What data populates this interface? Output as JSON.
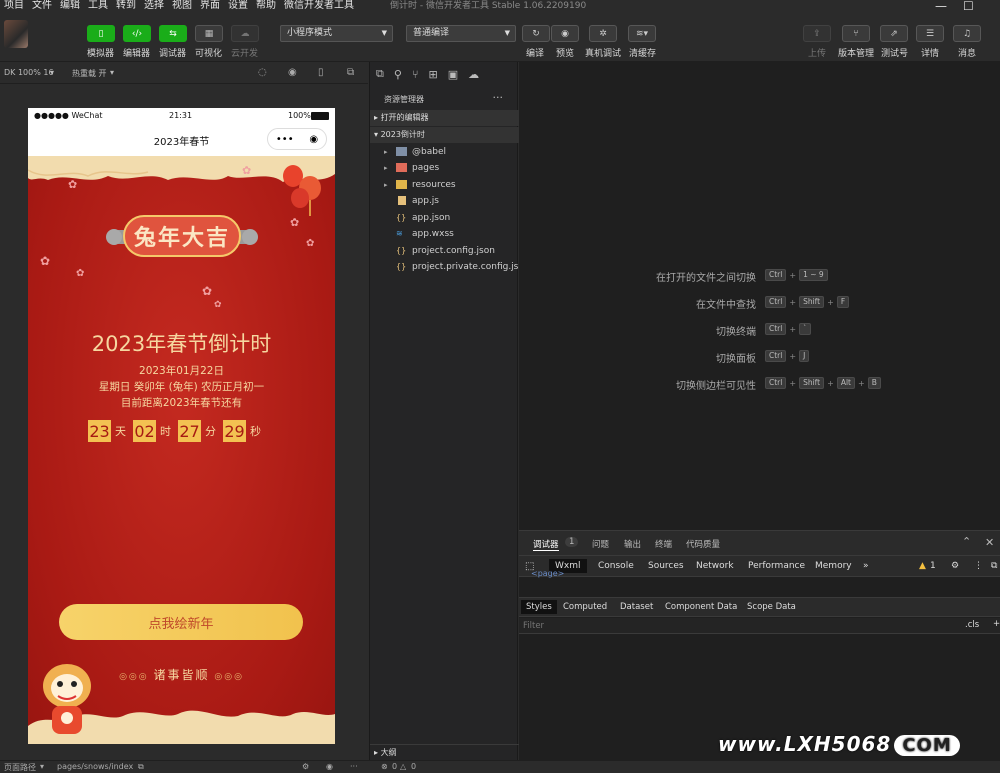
{
  "menu": [
    "项目",
    "文件",
    "编辑",
    "工具",
    "转到",
    "选择",
    "视图",
    "界面",
    "设置",
    "帮助",
    "微信开发者工具"
  ],
  "window_title": "倒计时      - 微信开发者工具 Stable 1.06.2209190",
  "toolbar": {
    "left_buttons": [
      {
        "label": "模拟器",
        "icon": "phone-icon"
      },
      {
        "label": "编辑器",
        "icon": "code-icon"
      },
      {
        "label": "调试器",
        "icon": "debug-icon"
      },
      {
        "label": "可视化",
        "icon": "layout-icon"
      },
      {
        "label": "云开发",
        "icon": "cloud-icon"
      }
    ],
    "mode_select": "小程序模式",
    "compile_select": "普通编译",
    "mid_buttons": [
      {
        "label": "编译",
        "icon": "refresh-icon"
      },
      {
        "label": "预览",
        "icon": "eye-icon"
      },
      {
        "label": "真机调试",
        "icon": "bug-icon"
      },
      {
        "label": "清缓存",
        "icon": "layers-icon"
      }
    ],
    "right_buttons": [
      {
        "label": "上传",
        "icon": "upload-icon"
      },
      {
        "label": "版本管理",
        "icon": "branch-icon"
      },
      {
        "label": "测试号",
        "icon": "external-icon"
      },
      {
        "label": "详情",
        "icon": "menu-icon"
      },
      {
        "label": "消息",
        "icon": "bell-icon"
      }
    ]
  },
  "simulator": {
    "device": "DK 100% 16",
    "hot_reload": "热重载 开",
    "status_carrier": "●●●●● WeChat",
    "status_time": "21:31",
    "status_battery": "100%",
    "nav_title": "2023年春节",
    "banner_text": "兔年大吉",
    "main_title": "2023年春节倒计时",
    "date": "2023年01月22日",
    "lunar": "星期日 癸卯年 (兔年)   农历正月初一",
    "until": "目前距离2023年春节还有",
    "countdown": [
      {
        "value": "23",
        "unit": "天"
      },
      {
        "value": "02",
        "unit": "时"
      },
      {
        "value": "27",
        "unit": "分"
      },
      {
        "value": "29",
        "unit": "秒"
      }
    ],
    "button": "点我绘新年",
    "blessing": "诸事皆顺"
  },
  "explorer": {
    "title": "资源管理器",
    "open_editors": "打开的编辑器",
    "project": "2023倒计时",
    "files": [
      {
        "name": "@babel",
        "type": "folder",
        "color": "#7f8fa6"
      },
      {
        "name": "pages",
        "type": "folder",
        "color": "#e06c5a"
      },
      {
        "name": "resources",
        "type": "folder",
        "color": "#e0b54a"
      },
      {
        "name": "app.js",
        "type": "js",
        "color": "#e5c07b"
      },
      {
        "name": "app.json",
        "type": "json",
        "color": "#e5c07b"
      },
      {
        "name": "app.wxss",
        "type": "wxss",
        "color": "#4a9fe0"
      },
      {
        "name": "project.config.json",
        "type": "json",
        "color": "#e5c07b"
      },
      {
        "name": "project.private.config.js...",
        "type": "json",
        "color": "#e5c07b"
      }
    ],
    "outline": "大纲"
  },
  "shortcuts": [
    {
      "label": "在打开的文件之间切换",
      "keys": [
        "Ctrl",
        "1 ~ 9"
      ]
    },
    {
      "label": "在文件中查找",
      "keys": [
        "Ctrl",
        "Shift",
        "F"
      ]
    },
    {
      "label": "切换终端",
      "keys": [
        "Ctrl",
        "`"
      ]
    },
    {
      "label": "切换面板",
      "keys": [
        "Ctrl",
        "J"
      ]
    },
    {
      "label": "切换侧边栏可见性",
      "keys": [
        "Ctrl",
        "Shift",
        "Alt",
        "B"
      ]
    }
  ],
  "devtools": {
    "top_tabs": [
      "调试器",
      "问题",
      "输出",
      "终端",
      "代码质量"
    ],
    "debugger_badge": "1",
    "panels": [
      "Wxml",
      "Console",
      "Sources",
      "Network",
      "Performance",
      "Memory"
    ],
    "warning_count": "1",
    "wxml_line": "<page>",
    "style_tabs": [
      "Styles",
      "Computed",
      "Dataset",
      "Component Data",
      "Scope Data"
    ],
    "filter_placeholder": "Filter",
    "cls": ".cls"
  },
  "statusbar": {
    "page_path_label": "页面路径",
    "page_path": "pages/snows/index",
    "errors": "0",
    "warnings": "0"
  },
  "watermark": {
    "main": "www.LXH5068",
    "com": "COM"
  }
}
